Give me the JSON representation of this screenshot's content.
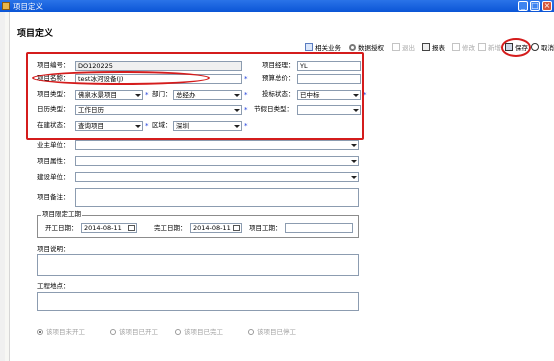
{
  "window": {
    "title": "项目定义",
    "minimize": "_",
    "maximize": "□",
    "close": "×"
  },
  "form": {
    "title": "项目定义"
  },
  "toolbar": [
    {
      "label": "相关业务",
      "icon": "related-icon",
      "enabled": true
    },
    {
      "label": "数据授权",
      "icon": "key-icon",
      "enabled": true
    },
    {
      "label": "退出",
      "icon": "exit-icon",
      "enabled": false
    },
    {
      "label": "报表",
      "icon": "report-icon",
      "enabled": true
    },
    {
      "label": "修改",
      "icon": "edit-icon",
      "enabled": false
    },
    {
      "label": "新增",
      "icon": "new-icon",
      "enabled": false
    },
    {
      "label": "保存",
      "icon": "save-icon",
      "enabled": true
    },
    {
      "label": "取消",
      "icon": "cancel-icon",
      "enabled": true
    }
  ],
  "fields": {
    "project_code": {
      "label": "项目编号：",
      "value": "DO120225"
    },
    "project_manager": {
      "label": "项目经理：",
      "value": "YL"
    },
    "project_name": {
      "label": "项目名称：",
      "value": "test冰河设备(J)"
    },
    "budget_total": {
      "label": "预算总价：",
      "value": ""
    },
    "project_type": {
      "label": "项目类型：",
      "value": "佛泉水景项目"
    },
    "department": {
      "label": "部门：",
      "value": "总经办"
    },
    "bid_status": {
      "label": "投标状态：",
      "value": "已中标"
    },
    "calendar_type": {
      "label": "日历类型：",
      "value": "工作日历"
    },
    "holiday_type": {
      "label": "节假日类型：",
      "value": ""
    },
    "build_status": {
      "label": "在建状态：",
      "value": "查询项目"
    },
    "region": {
      "label": "区域：",
      "value": "深圳"
    },
    "owner_unit": {
      "label": "业主单位：",
      "value": ""
    },
    "project_nature": {
      "label": "项目属性：",
      "value": ""
    },
    "construction_unit": {
      "label": "建设单位：",
      "value": ""
    },
    "remarks": {
      "label": "项目备注：",
      "value": ""
    },
    "schedule_legend": "项目限定工期",
    "start_date": {
      "label": "开工日期：",
      "value": "2014-08-11"
    },
    "end_date": {
      "label": "完工日期：",
      "value": "2014-08-11"
    },
    "duration": {
      "label": "项目工期：",
      "value": ""
    },
    "description": {
      "label": "项目说明：",
      "value": ""
    },
    "location": {
      "label": "工程地点：",
      "value": ""
    }
  },
  "status_radios": [
    {
      "label": "该项目未开工",
      "checked": true
    },
    {
      "label": "该项目已开工",
      "checked": false
    },
    {
      "label": "该项目已完工",
      "checked": false
    },
    {
      "label": "该项目已停工",
      "checked": false
    }
  ],
  "required_mark": "*",
  "colors": {
    "titlebar": "#0b55d6",
    "highlight": "#d41c1c",
    "required": "#1a3adb",
    "disabled": "#a8a8a8"
  }
}
